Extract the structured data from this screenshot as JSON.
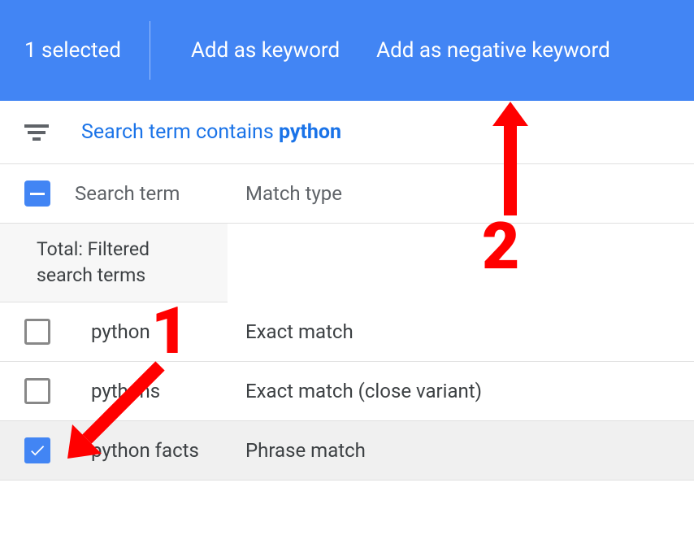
{
  "actionBar": {
    "selectedText": "1 selected",
    "addKeyword": "Add as keyword",
    "addNegative": "Add as negative keyword"
  },
  "filter": {
    "prefix": "Search term contains ",
    "value": "python"
  },
  "columns": {
    "term": "Search term",
    "match": "Match type"
  },
  "totalRow": "Total: Filtered search terms",
  "rows": [
    {
      "checked": false,
      "term": "python",
      "match": "Exact match"
    },
    {
      "checked": false,
      "term": "pythons",
      "match": "Exact match (close variant)"
    },
    {
      "checked": true,
      "term": "python facts",
      "match": "Phrase match"
    }
  ],
  "annotations": {
    "step1": "1",
    "step2": "2"
  }
}
